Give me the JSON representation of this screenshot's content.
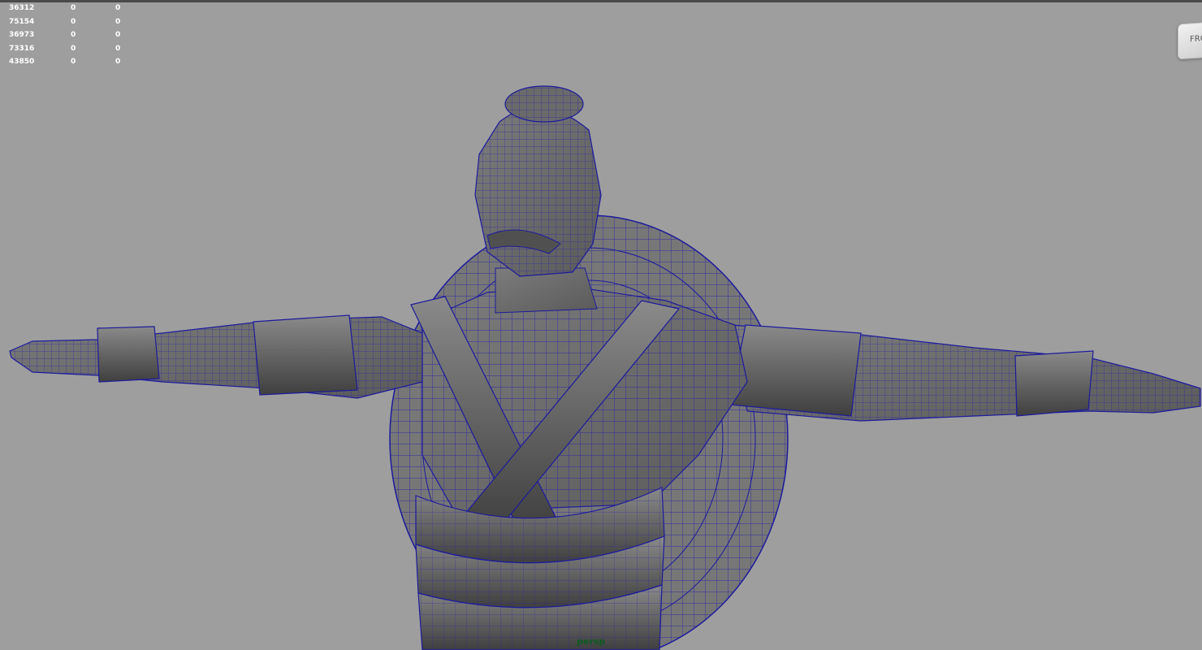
{
  "viewport": {
    "camera": "persp",
    "view_cube_face": "FRO"
  },
  "hud_stats": [
    [
      "36312",
      "0",
      "0"
    ],
    [
      "75154",
      "0",
      "0"
    ],
    [
      "36973",
      "0",
      "0"
    ],
    [
      "73316",
      "0",
      "0"
    ],
    [
      "43850",
      "0",
      "0"
    ]
  ],
  "colors": {
    "background": "#9e9e9e",
    "mesh_fill": "#6e6e6e",
    "wireframe": "#1c1a9c",
    "camera_label": "#0d5a1f"
  }
}
